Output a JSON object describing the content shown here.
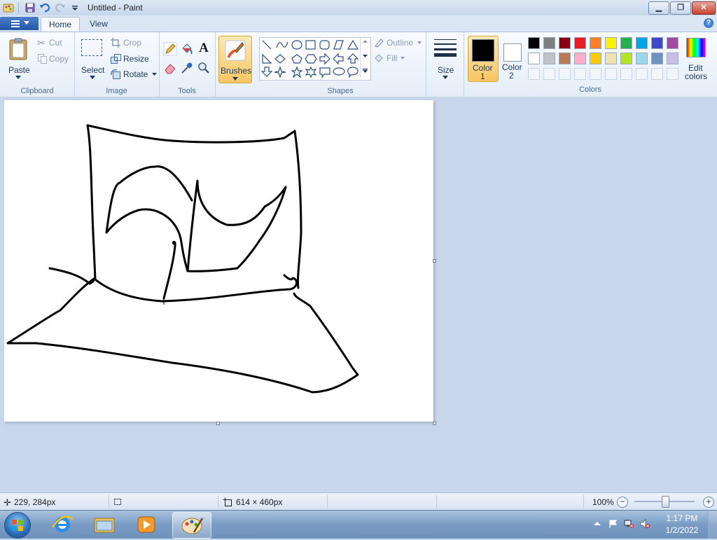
{
  "window": {
    "title": "Untitled - Paint",
    "tabs": [
      "Home",
      "View"
    ]
  },
  "clipboard": {
    "paste": "Paste",
    "cut": "Cut",
    "copy": "Copy",
    "group": "Clipboard"
  },
  "image": {
    "select": "Select",
    "crop": "Crop",
    "resize": "Resize",
    "rotate": "Rotate",
    "group": "Image"
  },
  "tools": {
    "group": "Tools",
    "brushes": "Brushes"
  },
  "shapes": {
    "outline": "Outline",
    "fill": "Fill",
    "group": "Shapes"
  },
  "size": {
    "label": "Size"
  },
  "colors": {
    "color1_line1": "Color",
    "color1_line2": "1",
    "color2_line1": "Color",
    "color2_line2": "2",
    "edit_line1": "Edit",
    "edit_line2": "colors",
    "group": "Colors",
    "color1_value": "#000000",
    "color2_value": "#ffffff",
    "palette_row1": [
      "#000000",
      "#7f7f7f",
      "#880015",
      "#ed1c24",
      "#ff7f27",
      "#fff200",
      "#22b14c",
      "#00a2e8",
      "#3f48cc",
      "#a349a4"
    ],
    "palette_row2": [
      "#ffffff",
      "#c3c3c3",
      "#b97a57",
      "#ffaec9",
      "#ffc90e",
      "#efe4b0",
      "#b5e61d",
      "#99d9ea",
      "#7092be",
      "#c8bfe7"
    ]
  },
  "status": {
    "cursor_pos": "229, 284px",
    "selection_size": "",
    "canvas_size": "614 × 460px",
    "zoom": "100%"
  },
  "taskbar": {
    "time": "1:17 PM",
    "date": "1/2/2022"
  }
}
